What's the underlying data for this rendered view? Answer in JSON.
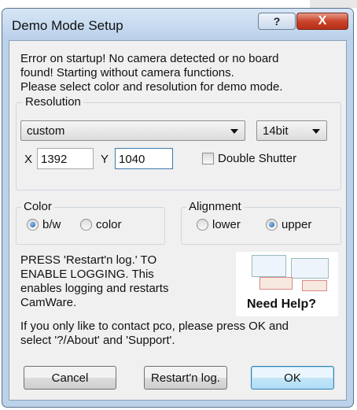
{
  "window": {
    "title": "Demo Mode Setup"
  },
  "titlebar": {
    "help_label": "?",
    "close_label": "X"
  },
  "message": {
    "line1": "Error on startup! No camera detected or no board",
    "line2": "found! Starting without camera functions.",
    "line3": "Please select color and resolution for demo mode."
  },
  "resolution": {
    "group_label": "Resolution",
    "preset_value": "custom",
    "bitdepth_value": "14bit",
    "x_label": "X",
    "x_value": "1392",
    "y_label": "Y",
    "y_value": "1040",
    "double_shutter_label": "Double Shutter"
  },
  "color": {
    "group_label": "Color",
    "bw_label": "b/w",
    "color_label": "color",
    "selected": "b/w"
  },
  "alignment": {
    "group_label": "Alignment",
    "lower_label": "lower",
    "upper_label": "upper",
    "selected": "upper"
  },
  "logging_text": {
    "line1": "PRESS 'Restart'n log.' TO",
    "line2": "ENABLE LOGGING. This",
    "line3": "enables logging and restarts",
    "line4": "CamWare."
  },
  "help_image": {
    "caption": "Need Help?"
  },
  "contact_text": {
    "line1": "If you only like to contact pco, please press OK and",
    "line2": "select '?/About' and 'Support'."
  },
  "buttons": {
    "cancel": "Cancel",
    "restart": "Restart'n log.",
    "ok": "OK"
  },
  "colors": {
    "frame": "#bcd2ea",
    "close_button": "#c9442b",
    "dialog_bg": "#f0f0f0",
    "default_button": "#c4e5f6"
  }
}
